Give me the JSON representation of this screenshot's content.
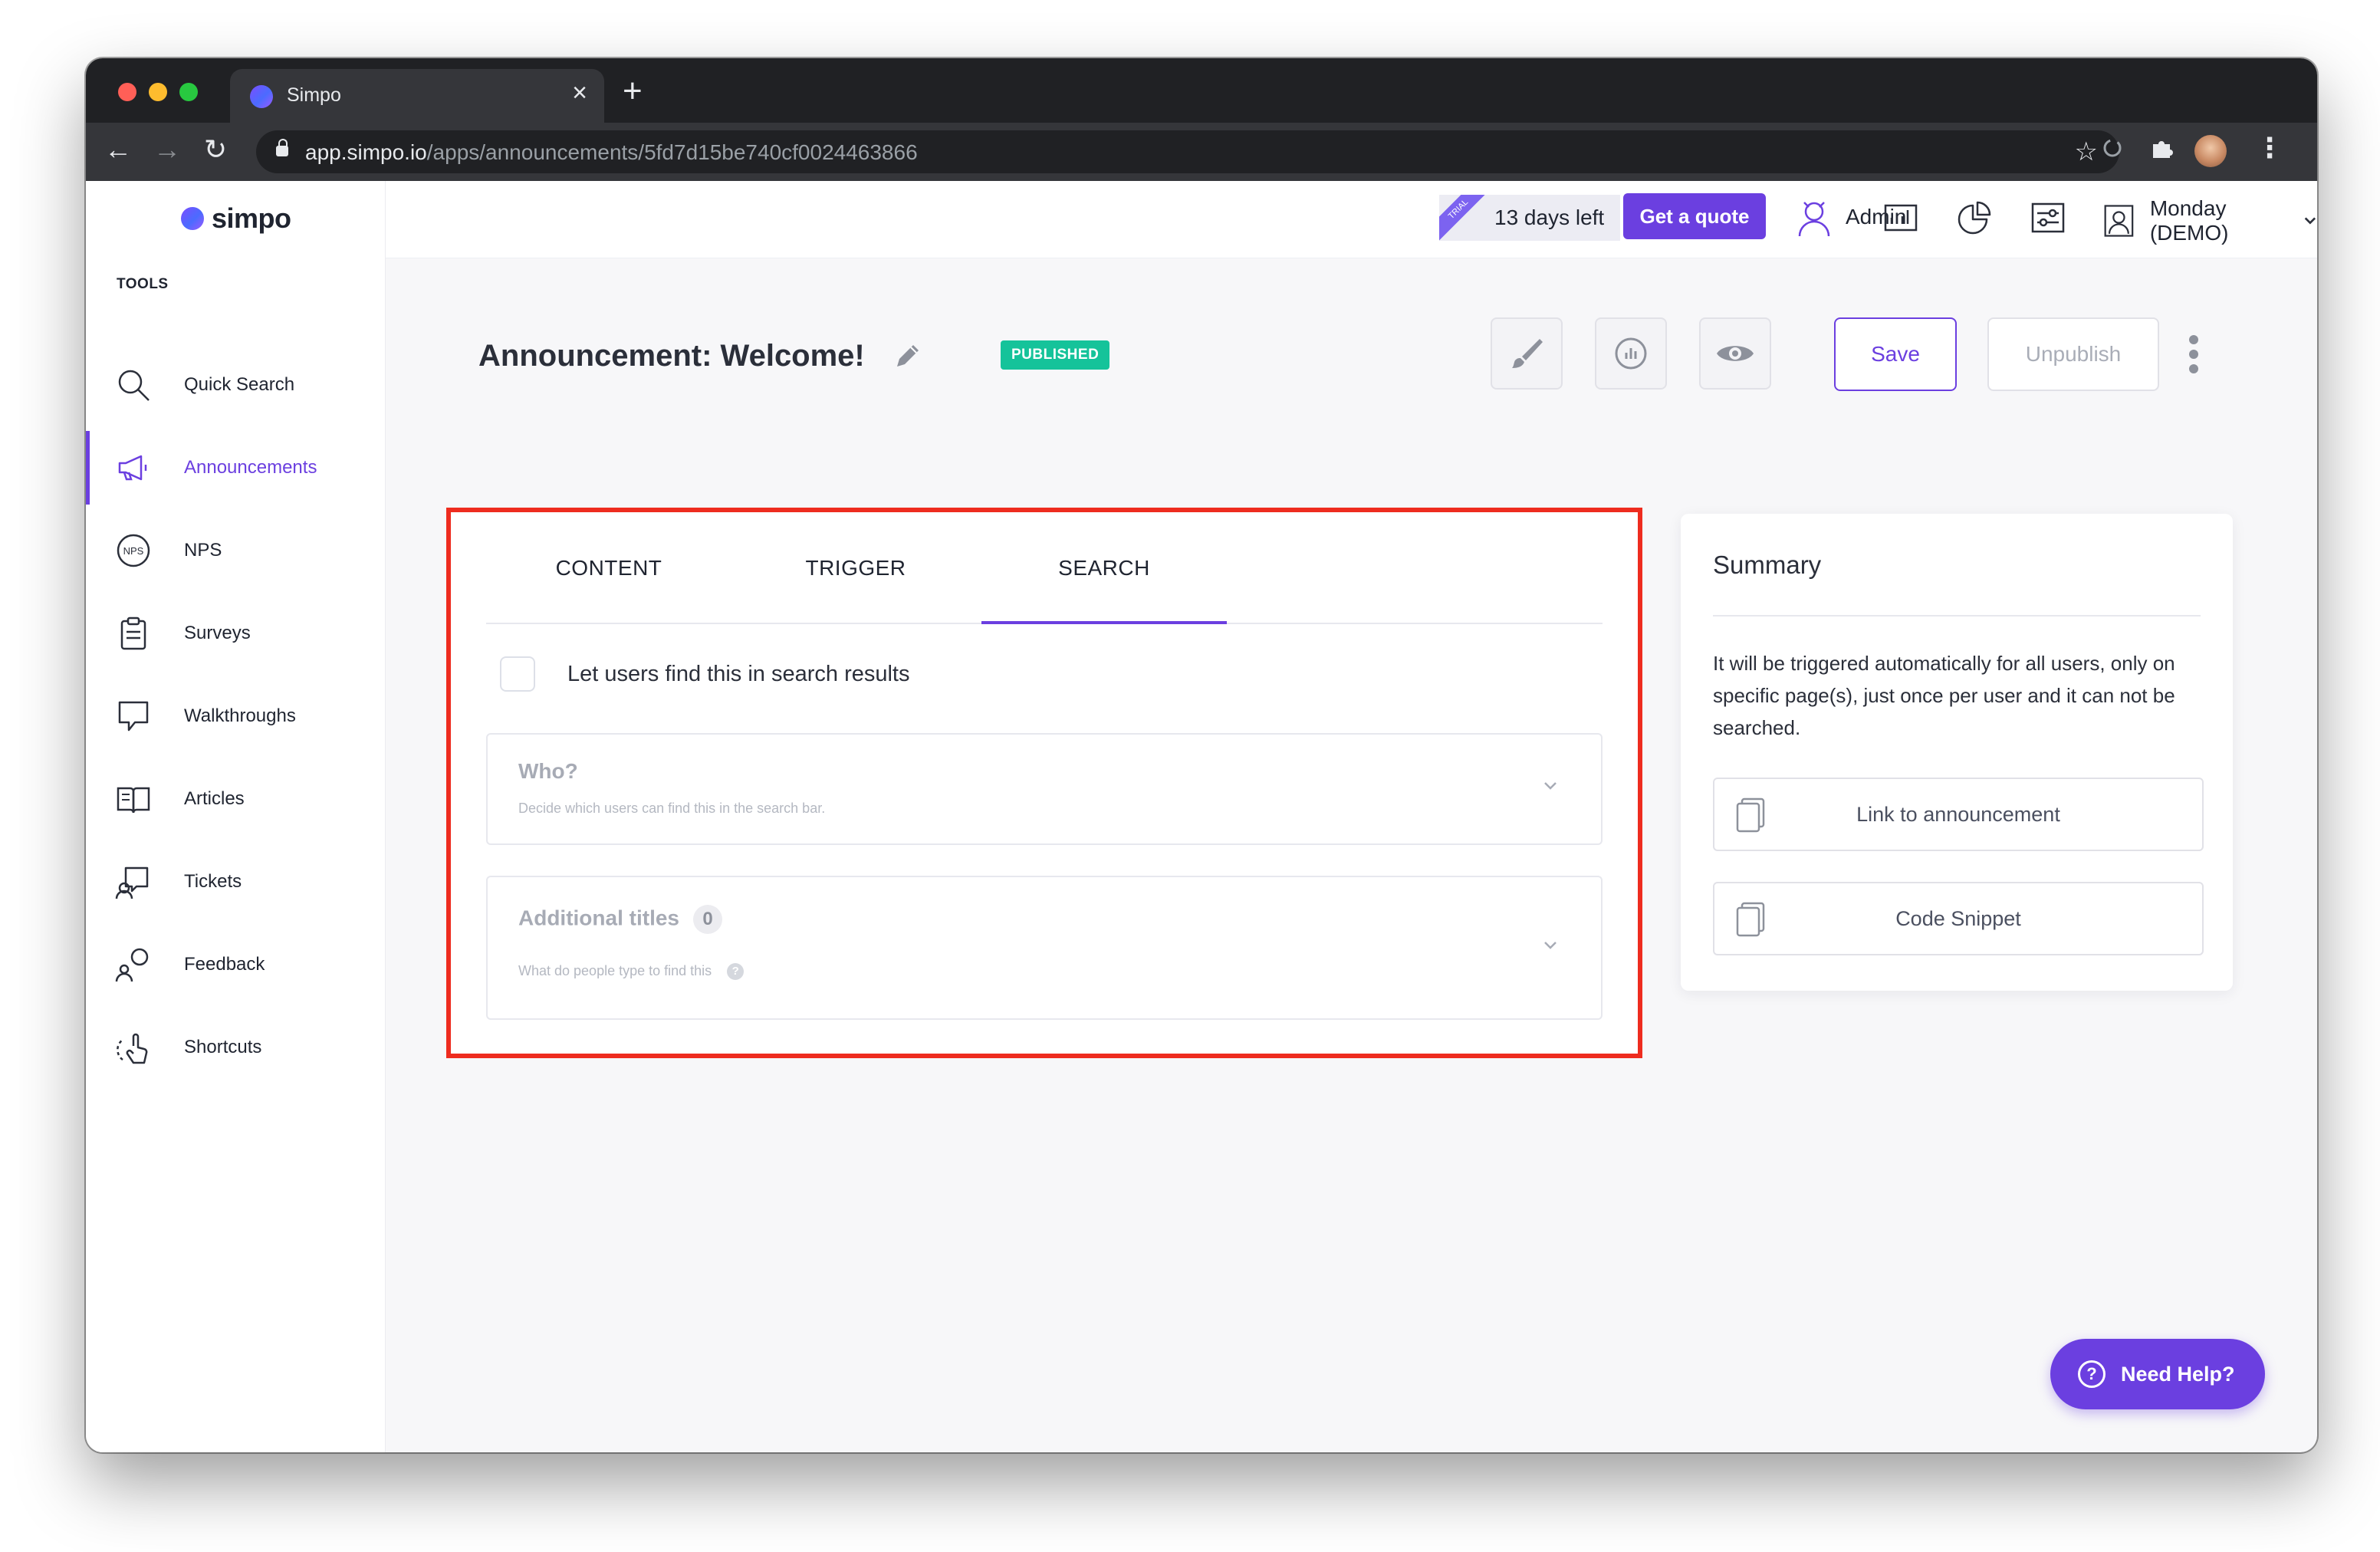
{
  "browser": {
    "tab_title": "Simpo",
    "tab_close": "×",
    "new_tab": "+",
    "url_host": "app.simpo.io",
    "url_path": "/apps/announcements/5fd7d15be740cf0024463866",
    "nav": {
      "back": "←",
      "forward": "→",
      "reload": "↻"
    },
    "star": "☆",
    "menu": "⋮",
    "icons": [
      "lock-icon",
      "star-icon",
      "sync-icon",
      "extensions-icon",
      "profile-avatar",
      "chrome-menu-icon"
    ]
  },
  "app": {
    "logo_text": "simpo",
    "sidebar": {
      "section_label": "TOOLS",
      "items": [
        {
          "label": "Quick Search",
          "icon": "search-icon",
          "active": false
        },
        {
          "label": "Announcements",
          "icon": "megaphone-icon",
          "active": true
        },
        {
          "label": "NPS",
          "icon": "nps-icon",
          "active": false
        },
        {
          "label": "Surveys",
          "icon": "clipboard-icon",
          "active": false
        },
        {
          "label": "Walkthroughs",
          "icon": "speech-bubble-icon",
          "active": false
        },
        {
          "label": "Articles",
          "icon": "book-icon",
          "active": false
        },
        {
          "label": "Tickets",
          "icon": "ticket-icon",
          "active": false
        },
        {
          "label": "Feedback",
          "icon": "feedback-icon",
          "active": false
        },
        {
          "label": "Shortcuts",
          "icon": "shortcut-icon",
          "active": false
        }
      ]
    },
    "topbar": {
      "trial_ribbon": "TRIAL",
      "trial_days": "13 days left",
      "quote_button": "Get a quote",
      "admin_label": "Admin",
      "user_label": "Monday (DEMO)",
      "user_chevron": "⌄",
      "icons": [
        "admin-icon",
        "analytics-icon",
        "pie-chart-icon",
        "settings-sliders-icon",
        "user-icon"
      ]
    },
    "page": {
      "title": "Announcement: Welcome!",
      "status_badge": "PUBLISHED",
      "save_button": "Save",
      "unpublish_button": "Unpublish",
      "action_icons": [
        "brush-icon",
        "stats-icon",
        "eye-icon",
        "more-vertical-icon"
      ]
    },
    "editor": {
      "tabs": [
        {
          "label": "CONTENT",
          "active": false
        },
        {
          "label": "TRIGGER",
          "active": false
        },
        {
          "label": "SEARCH",
          "active": true
        }
      ],
      "search_toggle_label": "Let users find this in search results",
      "search_toggle_checked": false,
      "who": {
        "title": "Who?",
        "description": "Decide which users can find this in the search bar."
      },
      "additional_titles": {
        "title": "Additional titles",
        "count": "0",
        "description": "What do people type to find this",
        "help": "?"
      }
    },
    "summary": {
      "title": "Summary",
      "description": "It will be triggered automatically for all users, only on specific page(s), just once per user and it can not be searched.",
      "link_button": "Link to announcement",
      "snippet_button": "Code Snippet"
    },
    "need_help": {
      "icon": "?",
      "label": "Need Help?"
    }
  },
  "colors": {
    "accent": "#6b3fe0",
    "published": "#15c39a",
    "highlight_border": "#ee2c1f",
    "text": "#2b2f3a",
    "muted": "#a7abb5"
  }
}
